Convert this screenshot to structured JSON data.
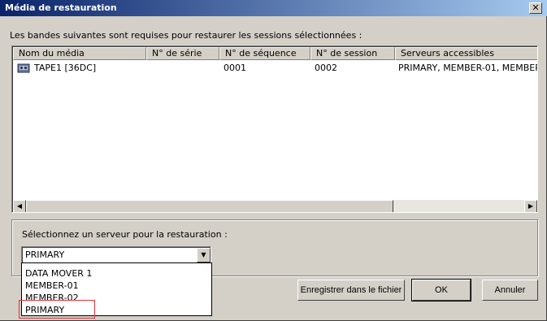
{
  "window": {
    "title": "Média de restauration",
    "close_glyph": "✕"
  },
  "intro_text": "Les bandes suivantes sont requises pour restaurer les sessions sélectionnées :",
  "table": {
    "columns": [
      "Nom du média",
      "N° de série",
      "N° de séquence",
      "N° de session",
      "Serveurs accessibles"
    ],
    "rows": [
      {
        "icon": "tape-icon",
        "media_name": "TAPE1 [36DC]",
        "serial": "",
        "sequence": "0001",
        "session": "0002",
        "servers": "PRIMARY, MEMBER-01, MEMBER"
      }
    ]
  },
  "server_group": {
    "label": "Sélectionnez un serveur pour la restauration :",
    "selected": "PRIMARY",
    "options": [
      "DATA MOVER 1",
      "MEMBER-01",
      "MEMBER-02",
      "PRIMARY"
    ]
  },
  "buttons": {
    "save_label": "Enregistrer dans le fichier",
    "ok_label": "OK",
    "cancel_label": "Annuler"
  },
  "highlight_color": "#e0323a"
}
